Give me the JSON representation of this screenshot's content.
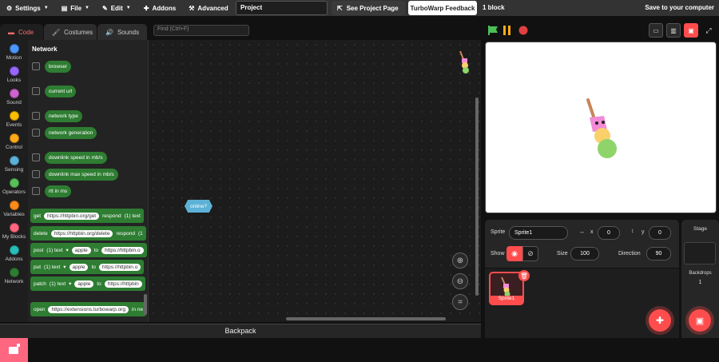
{
  "menu": {
    "settings": "Settings",
    "file": "File",
    "edit": "Edit",
    "addons": "Addons",
    "advanced": "Advanced",
    "project_title": "Project",
    "see_project_page": "See Project Page",
    "feedback": "TurboWarp Feedback",
    "block_count": "1 block",
    "save_computer": "Save to your computer"
  },
  "tabs": {
    "code": "Code",
    "costumes": "Costumes",
    "sounds": "Sounds"
  },
  "find_placeholder": "Find (Ctrl+F)",
  "categories": [
    {
      "label": "Motion",
      "color": "#4c97ff"
    },
    {
      "label": "Looks",
      "color": "#9966ff"
    },
    {
      "label": "Sound",
      "color": "#cf63cf"
    },
    {
      "label": "Events",
      "color": "#ffbf00"
    },
    {
      "label": "Control",
      "color": "#ffab19"
    },
    {
      "label": "Sensing",
      "color": "#5cb1d6"
    },
    {
      "label": "Operators",
      "color": "#59c059"
    },
    {
      "label": "Variables",
      "color": "#ff8c1a"
    },
    {
      "label": "My Blocks",
      "color": "#ff6680"
    },
    {
      "label": "Addons",
      "color": "#29beb8"
    },
    {
      "label": "Network",
      "color": "#2e7d32"
    }
  ],
  "palette": {
    "title": "Network",
    "reporters": [
      "browser",
      "current url",
      "network type",
      "network generation",
      "downlink speed in mb/s",
      "downlink max speed in mb/s",
      "rtt in ms"
    ],
    "get": {
      "label": "get",
      "url": "https://httpbin.org/get",
      "respond": "respond",
      "fmt": "(1) text"
    },
    "delete": {
      "label": "delete",
      "url": "https://httpbin.org/delete",
      "respond": "respond",
      "fmt": "(1"
    },
    "post": {
      "label": "post",
      "fmt": "(1) text",
      "value": "apple",
      "to": "to",
      "url": "https://httpbin.o"
    },
    "put": {
      "label": "put",
      "fmt": "(1) text",
      "value": "apple",
      "to": "to",
      "url": "https://httpbin.o"
    },
    "patch": {
      "label": "patch",
      "fmt": "(1) text",
      "value": "apple",
      "to": "to",
      "url": "https://httpbin"
    },
    "open": {
      "label": "open",
      "url": "https://extensions.turbowarp.org",
      "suffix": "in ne"
    }
  },
  "workspace": {
    "online_block": "online?",
    "backpack": "Backpack"
  },
  "sprite": {
    "sprite_label": "Sprite",
    "name": "Sprite1",
    "x_label": "x",
    "x": "0",
    "y_label": "y",
    "y": "0",
    "show_label": "Show",
    "size_label": "Size",
    "size": "100",
    "direction_label": "Direction",
    "direction": "90",
    "tile_name": "Sprite1"
  },
  "stage": {
    "title": "Stage",
    "backdrops_label": "Backdrops",
    "backdrops_count": "1"
  }
}
